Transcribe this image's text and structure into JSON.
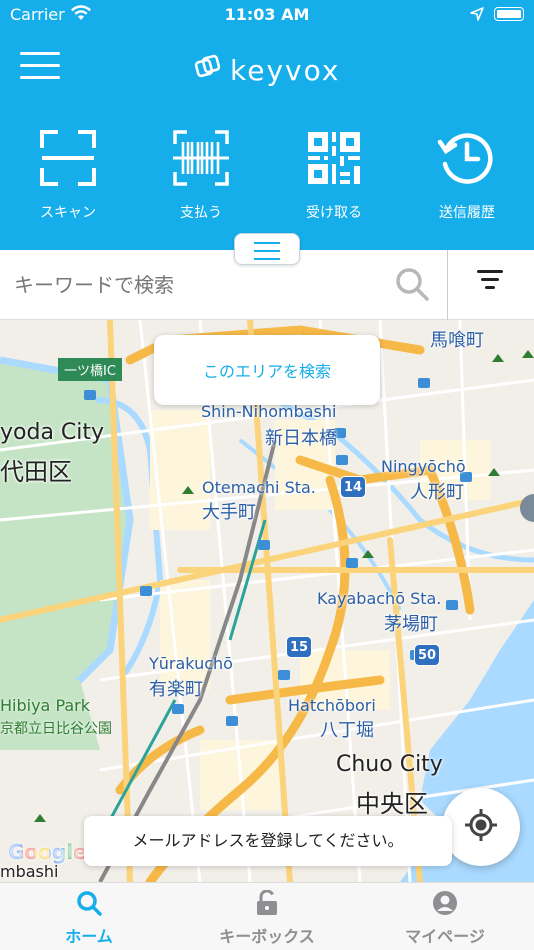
{
  "status_bar": {
    "carrier": "Carrier",
    "time": "11:03 AM"
  },
  "header": {
    "logo_text": "keyvox",
    "actions": [
      {
        "label": "スキャン",
        "icon": "scan-icon"
      },
      {
        "label": "支払う",
        "icon": "barcode-icon"
      },
      {
        "label": "受け取る",
        "icon": "qr-code-icon"
      },
      {
        "label": "送信履歴",
        "icon": "history-icon"
      }
    ]
  },
  "search": {
    "placeholder": "キーワードで検索"
  },
  "map": {
    "area_search_label": "このエリアを検索",
    "toast_message": "メールアドレスを登録してください。",
    "labels": {
      "shin_nihombashi_en": "Shin-Nihombashi",
      "shin_nihombashi_ja": "新日本橋",
      "chiyoda_en": "yoda City",
      "chiyoda_ja": "代田区",
      "otemachi_en": "Otemachi Sta.",
      "otemachi_ja": "大手町",
      "ningyocho_en": "Ningyōchō",
      "ningyocho_ja": "人形町",
      "bakuro_ja": "馬喰町",
      "kayabacho_en": "Kayabachō Sta.",
      "kayabacho_ja": "茅場町",
      "yurakucho_en": "Yūrakuchō",
      "yurakucho_ja": "有楽町",
      "hatchobori_en": "Hatchōbori",
      "hatchobori_ja": "八丁堀",
      "chuo_en": "Chuo City",
      "chuo_ja": "中央区",
      "hibiya_en": "Hibiya Park",
      "hibiya_ja": "京都立日比谷公園",
      "hitotsubashi_ic": "一ツ橋IC",
      "mbashi": "mbashi",
      "google": "Google",
      "route_14": "14",
      "route_15": "15",
      "route_50": "50"
    }
  },
  "tabs": [
    {
      "label": "ホーム",
      "icon": "search-icon",
      "active": true
    },
    {
      "label": "キーボックス",
      "icon": "lock-icon",
      "active": false
    },
    {
      "label": "マイページ",
      "icon": "user-icon",
      "active": false
    }
  ],
  "colors": {
    "accent": "#16aeea",
    "map_bg": "#f2efe9",
    "park": "#c5e4c5",
    "water": "#aadaff",
    "major_road": "#fbd37a"
  }
}
